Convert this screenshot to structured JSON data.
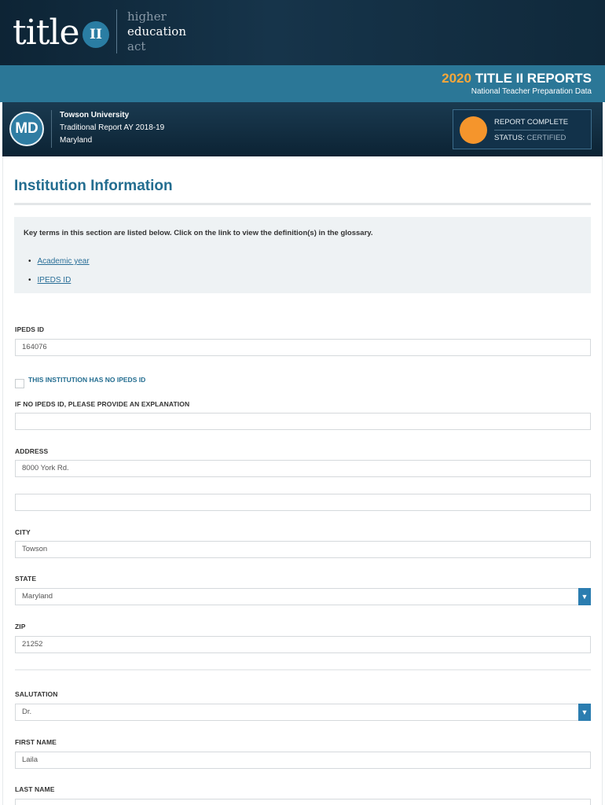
{
  "logo": {
    "title": "title",
    "badge": "II",
    "words": [
      "higher",
      "education",
      "act"
    ]
  },
  "report_bar": {
    "year": "2020",
    "title": "TITLE II REPORTS",
    "subtitle": "National Teacher Preparation Data"
  },
  "institution": {
    "state_code": "MD",
    "name": "Towson University",
    "report_type": "Traditional Report AY 2018-19",
    "state": "Maryland"
  },
  "status": {
    "line1": "REPORT COMPLETE",
    "label": "STATUS:",
    "value": "CERTIFIED",
    "colors": {
      "dot": "#f5952c"
    }
  },
  "section": {
    "title": "Institution Information",
    "glossary_intro": "Key terms in this section are listed below. Click on the link to view the definition(s) in the glossary.",
    "glossary_links": [
      "Academic year",
      "IPEDS ID"
    ]
  },
  "form": {
    "ipeds_label": "IPEDS ID",
    "ipeds_value": "164076",
    "no_ipeds_label": "THIS INSTITUTION HAS NO IPEDS ID",
    "explanation_label": "IF NO IPEDS ID, PLEASE PROVIDE AN EXPLANATION",
    "explanation_value": "",
    "address_label": "ADDRESS",
    "address_line1": "8000 York Rd.",
    "address_line2": "",
    "city_label": "CITY",
    "city_value": "Towson",
    "state_label": "STATE",
    "state_value": "Maryland",
    "zip_label": "ZIP",
    "zip_value": "21252",
    "salutation_label": "SALUTATION",
    "salutation_value": "Dr.",
    "first_name_label": "FIRST NAME",
    "first_name_value": "Laila",
    "last_name_label": "LAST NAME"
  },
  "colors": {
    "banner": "#10293b",
    "report_bar": "#2b7797",
    "accent_year": "#f4a73b",
    "section_title": "#236d90",
    "link": "#2a6f98",
    "select_arrow": "#2b7db0"
  }
}
